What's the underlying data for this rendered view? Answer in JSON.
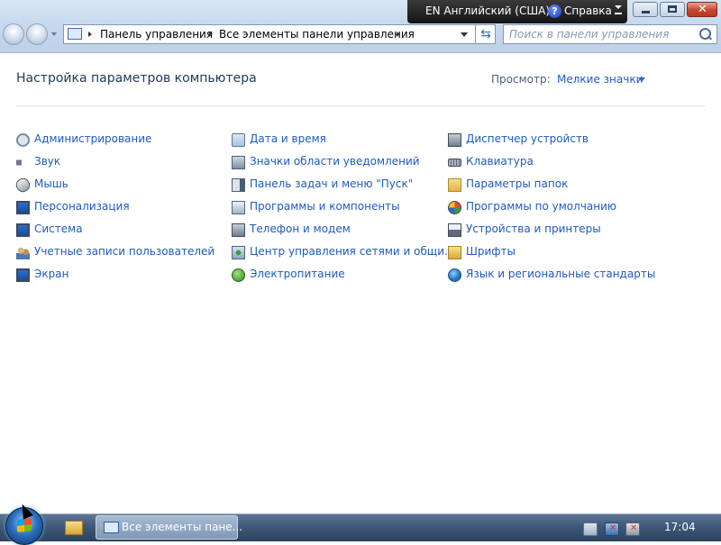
{
  "language_bar": {
    "language": "EN Английский (США)",
    "help": "Справка"
  },
  "address_bar": {
    "crumbs": [
      "Панель управления",
      "Все элементы панели управления"
    ]
  },
  "search": {
    "placeholder": "Поиск в панели управления"
  },
  "header": {
    "title": "Настройка параметров компьютера",
    "view_label": "Просмотр:",
    "view_value": "Мелкие значки"
  },
  "items": {
    "col1": [
      {
        "label": "Администрирование",
        "icon": "admin-tools-icon"
      },
      {
        "label": "Звук",
        "icon": "speaker-icon"
      },
      {
        "label": "Мышь",
        "icon": "mouse-icon"
      },
      {
        "label": "Персонализация",
        "icon": "personalization-icon"
      },
      {
        "label": "Система",
        "icon": "system-icon"
      },
      {
        "label": "Учетные записи пользователей",
        "icon": "users-icon"
      },
      {
        "label": "Экран",
        "icon": "display-icon"
      }
    ],
    "col2": [
      {
        "label": "Дата и время",
        "icon": "clock-icon"
      },
      {
        "label": "Значки области уведомлений",
        "icon": "notification-area-icon"
      },
      {
        "label": "Панель задач и меню \"Пуск\"",
        "icon": "taskbar-icon"
      },
      {
        "label": "Программы и компоненты",
        "icon": "programs-icon"
      },
      {
        "label": "Телефон и модем",
        "icon": "phone-modem-icon"
      },
      {
        "label": "Центр управления сетями и общи...",
        "icon": "network-center-icon"
      },
      {
        "label": "Электропитание",
        "icon": "power-icon"
      }
    ],
    "col3": [
      {
        "label": "Диспетчер устройств",
        "icon": "device-manager-icon"
      },
      {
        "label": "Клавиатура",
        "icon": "keyboard-icon"
      },
      {
        "label": "Параметры папок",
        "icon": "folder-options-icon"
      },
      {
        "label": "Программы по умолчанию",
        "icon": "default-programs-icon"
      },
      {
        "label": "Устройства и принтеры",
        "icon": "printer-icon"
      },
      {
        "label": "Шрифты",
        "icon": "fonts-icon"
      },
      {
        "label": "Язык и региональные стандарты",
        "icon": "globe-icon"
      }
    ]
  },
  "taskbar": {
    "window_label": "Все элементы пане...",
    "clock": "17:04"
  }
}
